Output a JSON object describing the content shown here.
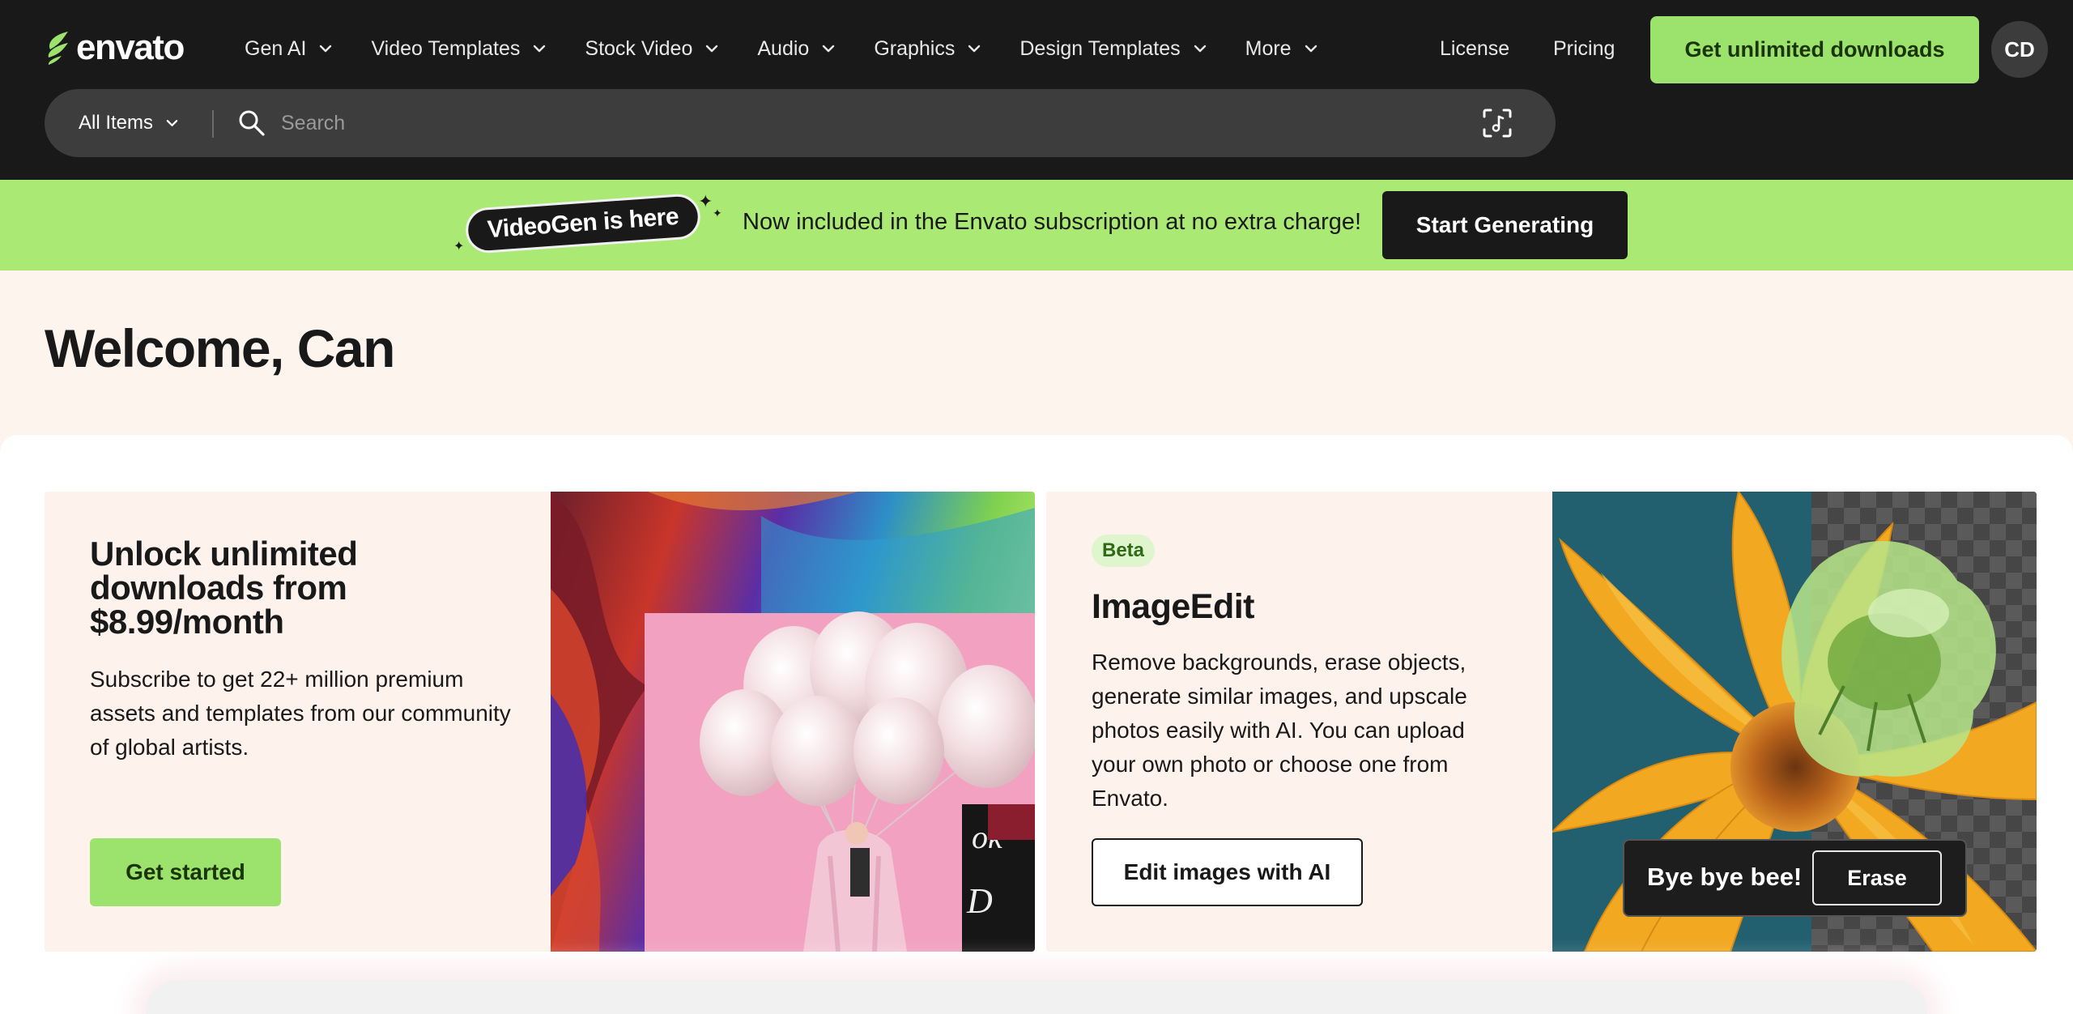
{
  "brand": {
    "name": "envato",
    "accent": "#9ce36d",
    "dark": "#191919",
    "promo_bg": "#aaea74",
    "page_bg": "#fdf4ee"
  },
  "nav": {
    "items": [
      {
        "label": "Gen AI"
      },
      {
        "label": "Video Templates"
      },
      {
        "label": "Stock Video"
      },
      {
        "label": "Audio"
      },
      {
        "label": "Graphics"
      },
      {
        "label": "Design Templates"
      },
      {
        "label": "More"
      }
    ],
    "license": "License",
    "pricing": "Pricing",
    "cta": "Get unlimited downloads",
    "avatar_initials": "CD"
  },
  "search": {
    "scope": "All Items",
    "placeholder": "Search",
    "value": "",
    "icons": {
      "search": "search-icon",
      "audio_search": "audio-search-icon"
    }
  },
  "promo": {
    "badge": "VideoGen is here",
    "text": "Now included in the Envato subscription at no extra charge!",
    "button": "Start Generating"
  },
  "welcome": {
    "title": "Welcome, Can"
  },
  "cards": [
    {
      "title": "Unlock unlimited downloads from $8.99/month",
      "description": "Subscribe to get 22+ million premium assets and templates from our community of global artists.",
      "button": "Get started"
    },
    {
      "badge": "Beta",
      "title": "ImageEdit",
      "description": "Remove backgrounds, erase objects, generate similar images, and upscale photos easily with AI. You can upload your own photo or choose one from Envato.",
      "button": "Edit images with AI",
      "overlay_text": "Bye bye bee!",
      "overlay_button": "Erase"
    }
  ]
}
